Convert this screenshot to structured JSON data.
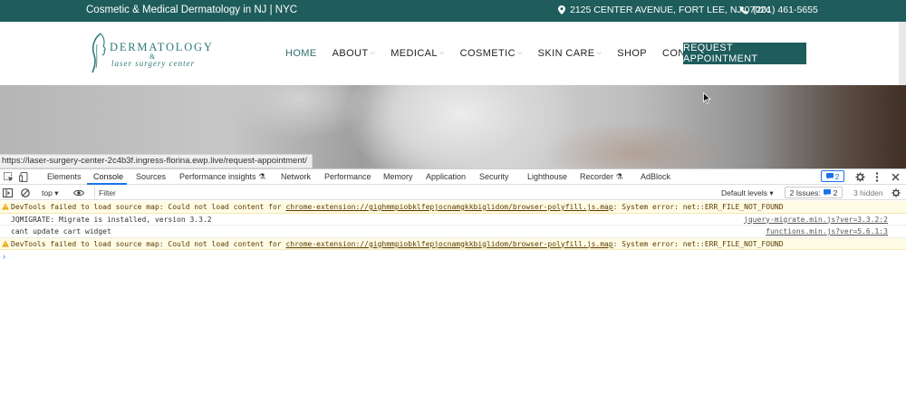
{
  "topbar": {
    "tagline": "Cosmetic & Medical Dermatology in NJ | NYC",
    "address": "2125 CENTER AVENUE, FORT LEE, NJ 07024",
    "phone": "(201) 461-5655",
    "address_icon": "map-pin-icon",
    "phone_icon": "phone-icon"
  },
  "logo": {
    "title": "DERMATOLOGY",
    "amp": "&",
    "subtitle": "laser surgery center"
  },
  "nav": {
    "items": [
      {
        "label": "HOME",
        "dropdown": false,
        "active": true
      },
      {
        "label": "ABOUT",
        "dropdown": true,
        "active": false
      },
      {
        "label": "MEDICAL",
        "dropdown": true,
        "active": false
      },
      {
        "label": "COSMETIC",
        "dropdown": true,
        "active": false
      },
      {
        "label": "SKIN CARE",
        "dropdown": true,
        "active": false
      },
      {
        "label": "SHOP",
        "dropdown": false,
        "active": false
      },
      {
        "label": "CONTACT",
        "dropdown": false,
        "active": false
      }
    ],
    "cta": "REQUEST APPOINTMENT"
  },
  "hero": {
    "status_url": "https://laser-surgery-center-2c4b3f.ingress-florina.ewp.live/request-appointment/"
  },
  "devtools": {
    "tabs": [
      "Elements",
      "Console",
      "Sources",
      "Performance insights",
      "Network",
      "Performance",
      "Memory",
      "Application",
      "Security",
      "Lighthouse",
      "Recorder",
      "AdBlock"
    ],
    "active_tab": "Console",
    "messages_badge": "2",
    "context": "top",
    "filter_placeholder": "Filter",
    "levels": "Default levels",
    "issues_label": "2 Issues:",
    "issues_count": "2",
    "hidden": "3 hidden",
    "console": [
      {
        "type": "warning",
        "pre": "DevTools failed to load source map: Could not load content for ",
        "link": "chrome-extension://gighmmpiobklfepjocnamgkkbiglidom/browser-polyfill.js.map",
        "post": ": System error: net::ERR_FILE_NOT_FOUND",
        "source": ""
      },
      {
        "type": "log",
        "pre": "JQMIGRATE: Migrate is installed, version 3.3.2",
        "link": "",
        "post": "",
        "source": "jquery-migrate.min.js?ver=3.3.2:2"
      },
      {
        "type": "log",
        "pre": "cant update cart widget",
        "link": "",
        "post": "",
        "source": "functions.min.js?ver=5.6.1:3"
      },
      {
        "type": "warning",
        "pre": "DevTools failed to load source map: Could not load content for ",
        "link": "chrome-extension://gighmmpiobklfepjocnamgkkbiglidom/browser-polyfill.js.map",
        "post": ": System error: net::ERR_FILE_NOT_FOUND",
        "source": ""
      }
    ],
    "prompt": "›"
  },
  "colors": {
    "brand": "#1f5c5c",
    "devtools_accent": "#1a73e8",
    "warning_bg": "#fffbe5"
  }
}
